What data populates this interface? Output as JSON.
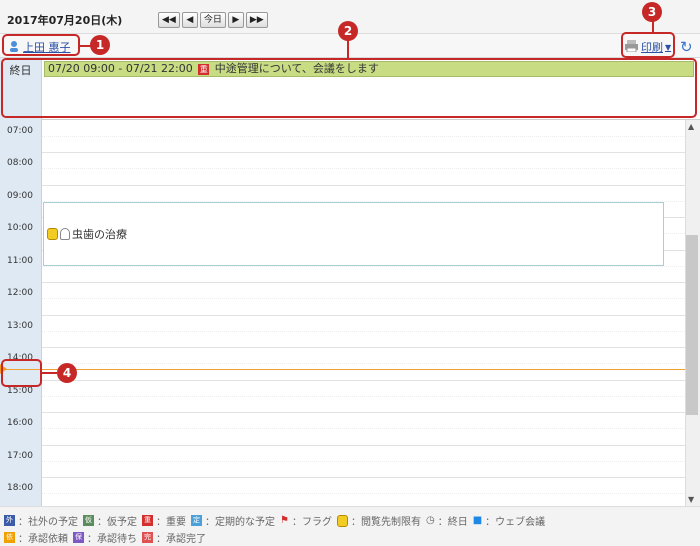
{
  "header": {
    "date": "2017年07月20日(木)",
    "today": "今日",
    "prev_prev": "◀◀",
    "prev": "◀",
    "next": "▶",
    "next_next": "▶▶"
  },
  "user_bar": {
    "user_name": "上田 惠子",
    "print_label": "印刷",
    "refresh_icon": "refresh-icon"
  },
  "allday": {
    "label": "終日",
    "event_time": "07/20 09:00 - 07/21 22:00",
    "event_badge": "重",
    "event_title": "中途管理について、会議をします"
  },
  "hours": [
    "07:00",
    "08:00",
    "09:00",
    "10:00",
    "11:00",
    "12:00",
    "13:00",
    "14:00",
    "15:00",
    "16:00",
    "17:00",
    "18:00"
  ],
  "event": {
    "title": "虫歯の治療"
  },
  "legend": {
    "items": [
      {
        "badge": "外",
        "label": "：社外の予定"
      },
      {
        "badge": "仮",
        "label": "：仮予定"
      },
      {
        "badge": "重",
        "label": "：重要"
      },
      {
        "badge": "定",
        "label": "：定期的な予定"
      },
      {
        "badge": "flag",
        "label": "：フラグ"
      },
      {
        "badge": "lock",
        "label": "：閲覧先制限有"
      },
      {
        "badge": "allday",
        "label": "：終日"
      },
      {
        "badge": "video",
        "label": "：ウェブ会議"
      },
      {
        "badge": "依",
        "label": "：承認依頼"
      },
      {
        "badge": "保",
        "label": "：承認待ち"
      },
      {
        "badge": "完",
        "label": "：承認完了"
      }
    ]
  },
  "annotations": [
    "1",
    "2",
    "3",
    "4"
  ],
  "colors": {
    "allday_event": "#c8dc84",
    "hour_column": "#dfe9f3",
    "callout": "#c62828",
    "current_time": "#f19a28"
  }
}
